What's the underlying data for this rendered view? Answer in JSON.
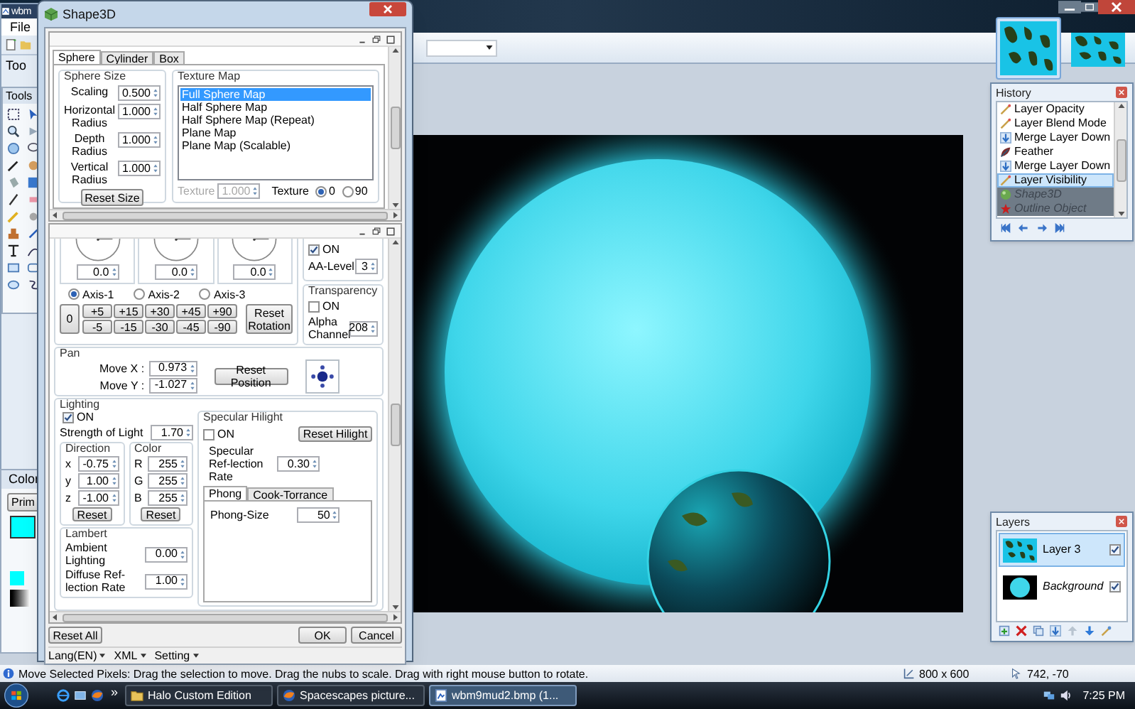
{
  "app": {
    "title": "wbm",
    "menu": [
      "File"
    ],
    "toolbar_label": "Too",
    "tools_panel": {
      "title": "Tools"
    },
    "colors_panel": {
      "title": "Color",
      "button": "Prim"
    },
    "image_tabs": [
      {
        "selected": true
      },
      {
        "selected": false
      }
    ]
  },
  "shape3d": {
    "title": "Shape3D",
    "tabs": [
      {
        "label": "Sphere",
        "selected": true
      },
      {
        "label": "Cylinder",
        "selected": false
      },
      {
        "label": "Box",
        "selected": false
      }
    ],
    "sphere_size": {
      "title": "Sphere Size",
      "fields": [
        {
          "label": "Scaling",
          "value": "0.500"
        },
        {
          "label": "Horizontal Radius",
          "value": "1.000"
        },
        {
          "label": "Depth Radius",
          "value": "1.000"
        },
        {
          "label": "Vertical Radius",
          "value": "1.000"
        }
      ],
      "button": "Reset Size"
    },
    "texture_map": {
      "title": "Texture Map",
      "items": [
        {
          "label": "Full Sphere Map",
          "selected": true
        },
        {
          "label": "Half Sphere Map",
          "selected": false
        },
        {
          "label": "Half Sphere Map (Repeat)",
          "selected": false
        },
        {
          "label": "Plane Map",
          "selected": false
        },
        {
          "label": "Plane Map (Scalable)",
          "selected": false
        }
      ],
      "scale": {
        "label": "Texture",
        "value": "1.000",
        "disabled": true
      },
      "angle": {
        "label": "Texture",
        "options": [
          {
            "label": "0",
            "selected": true
          },
          {
            "label": "90",
            "selected": false
          }
        ]
      }
    },
    "rotation": {
      "dials": [
        {
          "value": "0.0"
        },
        {
          "value": "0.0"
        },
        {
          "value": "0.0"
        }
      ],
      "axes": [
        {
          "label": "Axis-1",
          "selected": true
        },
        {
          "label": "Axis-2",
          "selected": false
        },
        {
          "label": "Axis-3",
          "selected": false
        }
      ],
      "zero_button": "0",
      "plus_buttons": [
        "+5",
        "+15",
        "+30",
        "+45",
        "+90"
      ],
      "minus_buttons": [
        "-5",
        "-15",
        "-30",
        "-45",
        "-90"
      ],
      "reset_button": "Reset Rotation"
    },
    "antialias": {
      "on": {
        "label": "ON",
        "checked": true
      },
      "level_label": "AA-Level",
      "level_value": "3"
    },
    "transparency": {
      "title": "Transparency",
      "on": {
        "label": "ON",
        "checked": false
      },
      "alpha_label": "Alpha Channel",
      "alpha_value": "208"
    },
    "pan": {
      "title": "Pan",
      "fields": [
        {
          "label": "Move X :",
          "value": "0.973"
        },
        {
          "label": "Move Y :",
          "value": "-1.027"
        }
      ],
      "button": "Reset Position"
    },
    "lighting": {
      "title": "Lighting",
      "on": {
        "label": "ON",
        "checked": true
      },
      "strength": {
        "label": "Strength of Light",
        "value": "1.70"
      },
      "direction": {
        "title": "Direction",
        "fields": [
          {
            "label": "x",
            "value": "-0.75"
          },
          {
            "label": "y",
            "value": "1.00"
          },
          {
            "label": "z",
            "value": "-1.00"
          }
        ],
        "button": "Reset"
      },
      "color": {
        "title": "Color",
        "fields": [
          {
            "label": "R",
            "value": "255"
          },
          {
            "label": "G",
            "value": "255"
          },
          {
            "label": "B",
            "value": "255"
          }
        ],
        "button": "Reset"
      },
      "lambert": {
        "title": "Lambert",
        "fields": [
          {
            "label": "Ambient Lighting",
            "value": "0.00"
          },
          {
            "label": "Diffuse Ref-lection Rate",
            "value": "1.00"
          }
        ]
      }
    },
    "specular": {
      "title": "Specular Hilight",
      "on": {
        "label": "ON",
        "checked": false
      },
      "button": "Reset Hilight",
      "rate": {
        "label": "Specular Ref-lection Rate",
        "value": "0.30"
      },
      "tabs": [
        {
          "label": "Phong",
          "selected": true
        },
        {
          "label": "Cook-Torrance",
          "selected": false
        }
      ],
      "phong_size": {
        "label": "Phong-Size",
        "value": "50"
      }
    },
    "buttons": {
      "reset_all": "Reset All",
      "ok": "OK",
      "cancel": "Cancel"
    },
    "menu": [
      "Lang(EN)",
      "XML",
      "Setting"
    ]
  },
  "history": {
    "title": "History",
    "items": [
      {
        "label": "Layer Opacity",
        "kind": "wand",
        "undone": false,
        "selected": false
      },
      {
        "label": "Layer Blend Mode",
        "kind": "wand",
        "undone": false,
        "selected": false
      },
      {
        "label": "Merge Layer Down",
        "kind": "merge",
        "undone": false,
        "selected": false
      },
      {
        "label": "Feather",
        "kind": "feather",
        "undone": false,
        "selected": false
      },
      {
        "label": "Merge Layer Down",
        "kind": "merge",
        "undone": false,
        "selected": false
      },
      {
        "label": "Layer Visibility",
        "kind": "wand",
        "undone": false,
        "selected": true
      },
      {
        "label": "Shape3D",
        "kind": "sphere",
        "undone": true,
        "selected": false
      },
      {
        "label": "Outline Object",
        "kind": "star",
        "undone": true,
        "selected": false
      }
    ]
  },
  "layers": {
    "title": "Layers",
    "items": [
      {
        "name": "Layer 3",
        "kind": "layer",
        "selected": true,
        "visible": true
      },
      {
        "name": "Background",
        "kind": "background",
        "selected": false,
        "visible": true
      }
    ]
  },
  "status_bar": {
    "message": "Move Selected Pixels: Drag the selection to move. Drag the nubs to scale. Drag with right mouse button to rotate.",
    "image_size": "800 x 600",
    "cursor": "742, -70"
  },
  "taskbar": {
    "overflow": "»",
    "tasks": [
      {
        "label": "Halo Custom Edition",
        "kind": "folder",
        "selected": false
      },
      {
        "label": "Spacescapes picture...",
        "kind": "browser",
        "selected": false
      },
      {
        "label": "wbm9mud2.bmp (1...",
        "kind": "image",
        "selected": true
      }
    ],
    "clock": "7:25 PM"
  }
}
